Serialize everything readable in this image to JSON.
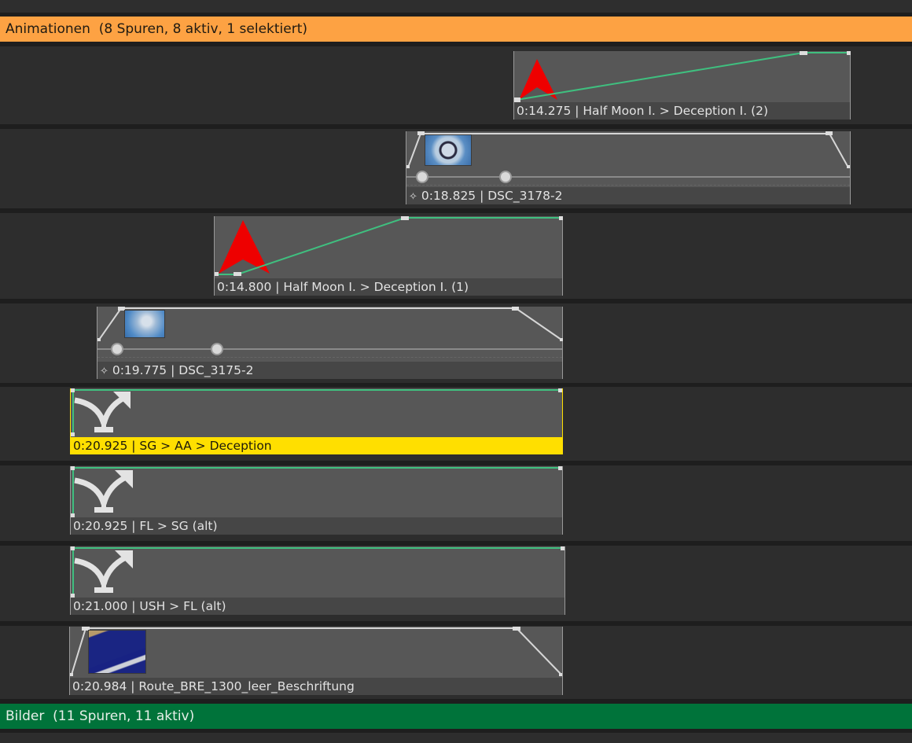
{
  "groups": {
    "animations": {
      "name": "Animationen",
      "summary": "(8 Spuren, 8 aktiv, 1 selektiert)",
      "color": "#fda243"
    },
    "images": {
      "name": "Bilder",
      "summary": "(11 Spuren, 11 aktiv)",
      "color": "#00733a"
    }
  },
  "tracks": [
    {
      "type": "camera-animation",
      "time": "0:14.275",
      "title": "Half Moon I. > Deception I. (2)",
      "label": "0:14.275 | Half Moon I. > Deception I. (2)",
      "icon": "red-arrow-icon",
      "selected": false
    },
    {
      "type": "image-animation",
      "time": "0:18.825",
      "title": "DSC_3178-2",
      "label": "0:18.825 | DSC_3178-2",
      "icon": "sparkle-icon",
      "selected": false
    },
    {
      "type": "camera-animation",
      "time": "0:14.800",
      "title": "Half Moon I. > Deception I. (1)",
      "label": "0:14.800 | Half Moon I. > Deception I. (1)",
      "icon": "red-arrow-icon",
      "selected": false
    },
    {
      "type": "image-animation",
      "time": "0:19.775",
      "title": "DSC_3175-2",
      "label": "0:19.775 | DSC_3175-2",
      "icon": "sparkle-icon",
      "selected": false
    },
    {
      "type": "route",
      "time": "0:20.925",
      "title": "SG > AA > Deception",
      "label": "0:20.925 | SG > AA > Deception",
      "icon": "route-split-icon",
      "selected": true
    },
    {
      "type": "route",
      "time": "0:20.925",
      "title": "FL > SG (alt)",
      "label": "0:20.925 | FL > SG (alt)",
      "icon": "route-split-icon",
      "selected": false
    },
    {
      "type": "route",
      "time": "0:21.000",
      "title": "USH > FL (alt)",
      "label": "0:21.000 | USH > FL (alt)",
      "icon": "route-split-icon",
      "selected": false
    },
    {
      "type": "image",
      "time": "0:20.984",
      "title": "Route_BRE_1300_leer_Beschriftung",
      "label": "0:20.984 | Route_BRE_1300_leer_Beschriftung",
      "icon": "map-thumbnail",
      "selected": false
    }
  ],
  "colors": {
    "selected": "#ffdf00",
    "curve_green": "#3fbf7f",
    "arrow_red": "#ee0000"
  }
}
